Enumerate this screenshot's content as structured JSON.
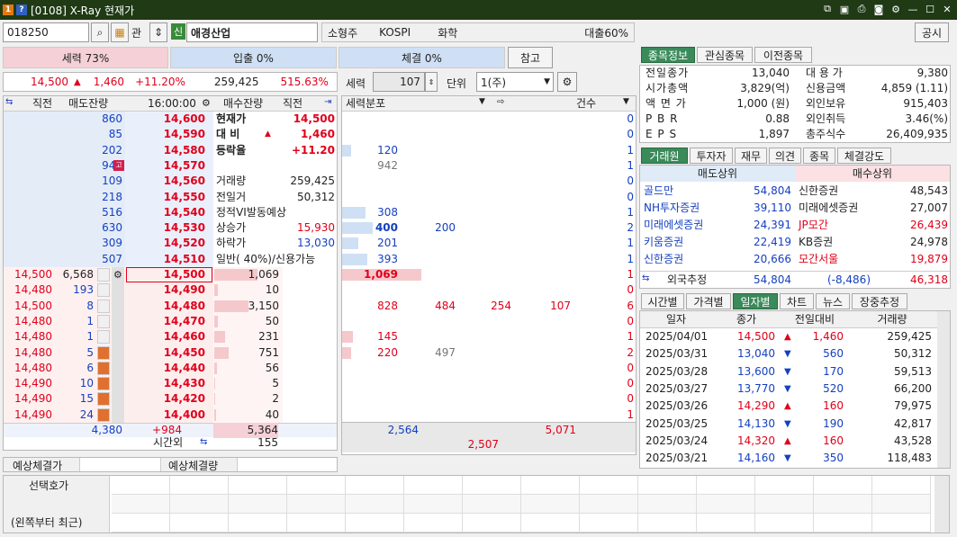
{
  "window": {
    "badge1": "1",
    "badge2": "?",
    "title": "[0108] X-Ray 현재가"
  },
  "toolbar": {
    "code": "018250",
    "mgmt": "관",
    "sin": "신",
    "name": "애경산업",
    "tags": [
      "소형주",
      "KOSPI",
      "화학"
    ],
    "loan": "대출60%",
    "notice": "공시",
    "ref_button": "참고"
  },
  "bars": {
    "force": "세력 73%",
    "inflow": "입출 0%",
    "trade": "체결 0%"
  },
  "quote": {
    "price": "14,500",
    "arrow": "▲",
    "change": "1,460",
    "rate": "+11.20%",
    "volume": "259,425",
    "turnover": "515.63%"
  },
  "ctrl": {
    "force_label": "세력",
    "force_value": "107",
    "unit_label": "단위",
    "unit_value": "1(주)"
  },
  "orderbook": {
    "headers": {
      "exec": "직전",
      "ask_qty": "매도잔량",
      "time": "16:00:00",
      "bid_qty": "매수잔량",
      "exec2": "직전"
    },
    "asks": [
      {
        "qty": "860",
        "price": "14,600"
      },
      {
        "qty": "85",
        "price": "14,590"
      },
      {
        "qty": "202",
        "price": "14,580"
      },
      {
        "qty": "944",
        "price": "14,570"
      },
      {
        "qty": "109",
        "price": "14,560"
      },
      {
        "qty": "218",
        "price": "14,550"
      },
      {
        "qty": "516",
        "price": "14,540"
      },
      {
        "qty": "630",
        "price": "14,530"
      },
      {
        "qty": "309",
        "price": "14,520"
      },
      {
        "qty": "507",
        "price": "14,510"
      }
    ],
    "bids": [
      {
        "price": "14,500",
        "qty": "1,069"
      },
      {
        "price": "14,490",
        "qty": "10"
      },
      {
        "price": "14,480",
        "qty": "3,150"
      },
      {
        "price": "14,470",
        "qty": "50"
      },
      {
        "price": "14,460",
        "qty": "231"
      },
      {
        "price": "14,450",
        "qty": "751"
      },
      {
        "price": "14,440",
        "qty": "56"
      },
      {
        "price": "14,430",
        "qty": "5"
      },
      {
        "price": "14,420",
        "qty": "2"
      },
      {
        "price": "14,400",
        "qty": "40"
      }
    ],
    "trades": [
      {
        "p": "14,500",
        "q": "6,568"
      },
      {
        "p": "14,480",
        "q": "193"
      },
      {
        "p": "14,500",
        "q": "8"
      },
      {
        "p": "14,480",
        "q": "1"
      },
      {
        "p": "14,480",
        "q": "1"
      },
      {
        "p": "14,480",
        "q": "5"
      },
      {
        "p": "14,480",
        "q": "6"
      },
      {
        "p": "14,490",
        "q": "10"
      },
      {
        "p": "14,490",
        "q": "15"
      },
      {
        "p": "14,490",
        "q": "24"
      }
    ],
    "info": [
      {
        "k": "현재가",
        "v": "14,500"
      },
      {
        "k": "대 비",
        "v": "1,460",
        "arrow": "▲"
      },
      {
        "k": "등락율",
        "v": "+11.20"
      },
      {
        "k": "",
        "v": ""
      },
      {
        "k": "거래량",
        "v": "259,425"
      },
      {
        "k": "전일거",
        "v": "50,312"
      },
      {
        "k": "정적VI발동예상",
        "v": ""
      },
      {
        "k": "상승가",
        "v": "15,930"
      },
      {
        "k": "하락가",
        "v": "13,030"
      },
      {
        "k": "일반( 40%)/신용가능",
        "v": ""
      }
    ],
    "footer": {
      "ask_total": "4,380",
      "diff": "+984",
      "bid_total": "5,364",
      "after_label": "시간외",
      "after_value": "155"
    },
    "expect": {
      "l1": "예상체결가",
      "l2": "예상체결량"
    }
  },
  "force": {
    "header": "세력분포",
    "count": "건수",
    "rows": [
      {
        "a": "",
        "b": "",
        "c": "",
        "d": "",
        "e": "",
        "n": "0"
      },
      {
        "a": "",
        "b": "",
        "c": "",
        "d": "",
        "e": "",
        "n": "0"
      },
      {
        "a": "120",
        "b": "",
        "c": "",
        "d": "",
        "e": "",
        "n": "1"
      },
      {
        "a": "942",
        "b": "",
        "c": "",
        "d": "",
        "e": "",
        "n": "1"
      },
      {
        "a": "",
        "b": "",
        "c": "",
        "d": "",
        "e": "",
        "n": "0"
      },
      {
        "a": "",
        "b": "",
        "c": "",
        "d": "",
        "e": "",
        "n": "0"
      },
      {
        "a": "308",
        "b": "",
        "c": "",
        "d": "",
        "e": "",
        "n": "1"
      },
      {
        "a": "400",
        "b": "200",
        "c": "",
        "d": "",
        "e": "",
        "n": "2"
      },
      {
        "a": "201",
        "b": "",
        "c": "",
        "d": "",
        "e": "",
        "n": "1"
      },
      {
        "a": "393",
        "b": "",
        "c": "",
        "d": "",
        "e": "",
        "n": "1"
      },
      {
        "a": "1,069",
        "b": "",
        "c": "",
        "d": "",
        "e": "",
        "n": "1"
      },
      {
        "a": "",
        "b": "",
        "c": "",
        "d": "",
        "e": "",
        "n": "0"
      },
      {
        "a": "828",
        "b": "484",
        "c": "254",
        "d": "107",
        "e": "",
        "n": "6"
      },
      {
        "a": "",
        "b": "",
        "c": "",
        "d": "",
        "e": "",
        "n": "0"
      },
      {
        "a": "145",
        "b": "",
        "c": "",
        "d": "",
        "e": "",
        "n": "1"
      },
      {
        "a": "220",
        "b": "497",
        "c": "",
        "d": "",
        "e": "",
        "n": "2"
      },
      {
        "a": "",
        "b": "",
        "c": "",
        "d": "",
        "e": "",
        "n": "0"
      },
      {
        "a": "",
        "b": "",
        "c": "",
        "d": "",
        "e": "",
        "n": "0"
      },
      {
        "a": "",
        "b": "",
        "c": "",
        "d": "",
        "e": "",
        "n": "0"
      },
      {
        "a": "",
        "b": "",
        "c": "",
        "d": "",
        "e": "",
        "n": "1"
      }
    ],
    "sum_blue": "2,564",
    "sum_red1": "5,071",
    "sum_red2": "2,507"
  },
  "tabs1": [
    "종목정보",
    "관심종목",
    "이전종목"
  ],
  "stockinfo": [
    {
      "k": "전일종가",
      "v": "13,040",
      "k2": "대 용 가",
      "v2": "9,380"
    },
    {
      "k": "시가총액",
      "v": "3,829(억)",
      "k2": "신용금액",
      "v2": "4,859  (1.11)"
    },
    {
      "k": "액 면 가",
      "v": "1,000 (원)",
      "k2": "외인보유",
      "v2": "915,403"
    },
    {
      "k": "P B R",
      "v": "0.88",
      "k2": "외인취득",
      "v2": "3.46(%)"
    },
    {
      "k": "E P S",
      "v": "1,897",
      "k2": "총주식수",
      "v2": "26,409,935"
    }
  ],
  "tabs2": [
    "거래원",
    "투자자",
    "재무",
    "의견",
    "종목",
    "체결강도"
  ],
  "brokers": {
    "sell_header": "매도상위",
    "buy_header": "매수상위",
    "rows": [
      {
        "s": "골드만",
        "sq": "54,804",
        "b": "신한증권",
        "bq": "48,543"
      },
      {
        "s": "NH투자증권",
        "sq": "39,110",
        "b": "미래에셋증권",
        "bq": "27,007"
      },
      {
        "s": "미래에셋증권",
        "sq": "24,391",
        "b": "JP모간",
        "bq": "26,439"
      },
      {
        "s": "키움증권",
        "sq": "22,419",
        "b": "KB증권",
        "bq": "24,978"
      },
      {
        "s": "신한증권",
        "sq": "20,666",
        "b": "모간서울",
        "bq": "19,879"
      }
    ],
    "foreign_label": "외국추정",
    "foreign_sell": "54,804",
    "foreign_diff": "(-8,486)",
    "foreign_buy": "46,318"
  },
  "tabs3": [
    "시간별",
    "가격별",
    "일자별",
    "차트",
    "뉴스",
    "장중추정"
  ],
  "daily": {
    "headers": [
      "일자",
      "종가",
      "전일대비",
      "거래량"
    ],
    "rows": [
      {
        "d": "2025/04/01",
        "c": "14,500",
        "a": "▲",
        "ch": "1,460",
        "v": "259,425",
        "up": true
      },
      {
        "d": "2025/03/31",
        "c": "13,040",
        "a": "▼",
        "ch": "560",
        "v": "50,312",
        "up": false
      },
      {
        "d": "2025/03/28",
        "c": "13,600",
        "a": "▼",
        "ch": "170",
        "v": "59,513",
        "up": false
      },
      {
        "d": "2025/03/27",
        "c": "13,770",
        "a": "▼",
        "ch": "520",
        "v": "66,200",
        "up": false
      },
      {
        "d": "2025/03/26",
        "c": "14,290",
        "a": "▲",
        "ch": "160",
        "v": "79,975",
        "up": true
      },
      {
        "d": "2025/03/25",
        "c": "14,130",
        "a": "▼",
        "ch": "190",
        "v": "42,817",
        "up": false
      },
      {
        "d": "2025/03/24",
        "c": "14,320",
        "a": "▲",
        "ch": "160",
        "v": "43,528",
        "up": true
      },
      {
        "d": "2025/03/21",
        "c": "14,160",
        "a": "▼",
        "ch": "350",
        "v": "118,483",
        "up": false
      }
    ]
  },
  "bottom": {
    "l1": "선택호가",
    "l2": "(왼쪽부터 최근)"
  }
}
